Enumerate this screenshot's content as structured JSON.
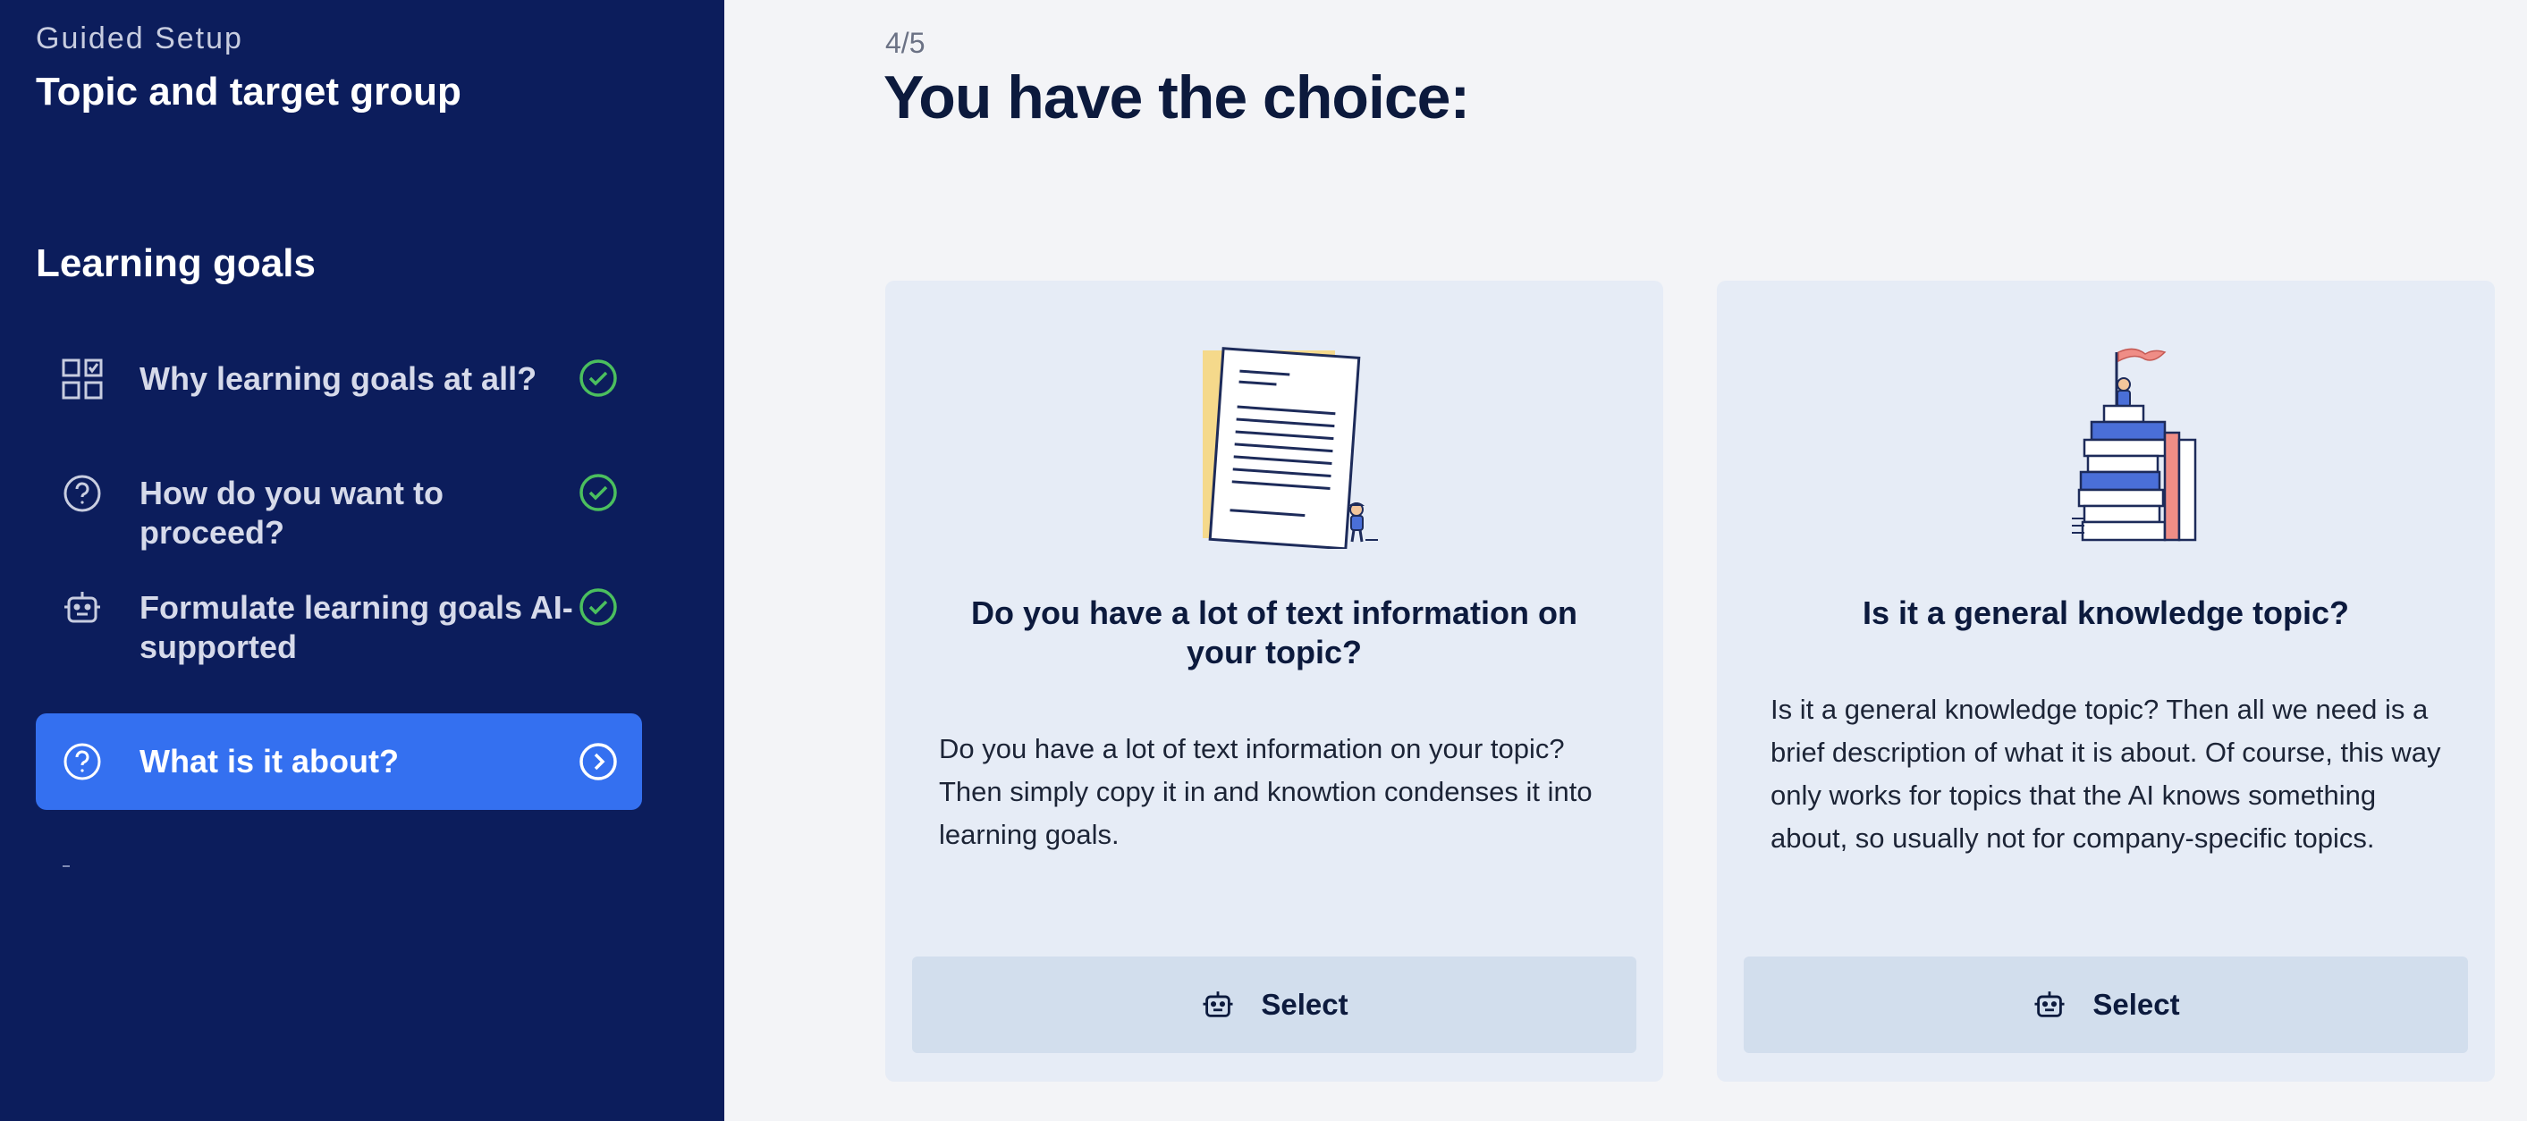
{
  "sidebar": {
    "eyebrow": "Guided Setup",
    "title": "Topic and target group",
    "section_title": "Learning goals",
    "steps": [
      {
        "label": "Why learning goals at all?",
        "icon": "grid-check-icon",
        "status": "completed"
      },
      {
        "label": "How do you want to proceed?",
        "icon": "question-circle-icon",
        "status": "completed"
      },
      {
        "label": "Formulate learning goals AI-supported",
        "icon": "robot-icon",
        "status": "completed"
      },
      {
        "label": "What is it about?",
        "icon": "question-circle-icon",
        "status": "active"
      }
    ]
  },
  "main": {
    "progress": "4/5",
    "title": "You have the choice:",
    "cards": [
      {
        "title": "Do you have a lot of text information on your topic?",
        "body": "Do you have a lot of text information on your topic? Then simply copy it in and knowtion condenses it into learning goals.",
        "button": "Select",
        "illustration": "document-person-illustration"
      },
      {
        "title": "Is it a general knowledge topic?",
        "body": "Is it a general knowledge topic? Then all we need is a brief description of what it is about. Of course, this way only works for topics that the AI knows something about, so usually not for company-specific topics.",
        "button": "Select",
        "illustration": "books-flag-illustration"
      }
    ]
  },
  "colors": {
    "sidebar_bg": "#0c1d5c",
    "active_step": "#3470f0",
    "check_green": "#4bbf5e",
    "card_bg": "#e6ecf6",
    "button_bg": "#d2deed"
  }
}
